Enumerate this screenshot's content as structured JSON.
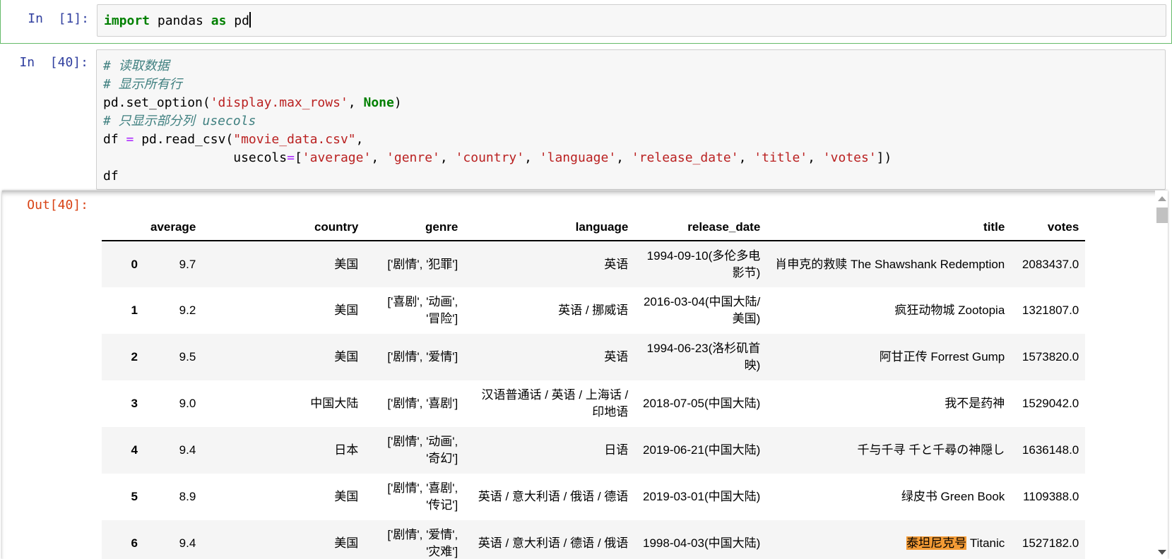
{
  "cells": [
    {
      "prompt": "In  [1]:",
      "lines": [
        [
          {
            "t": "kw",
            "v": "import"
          },
          {
            "t": "n",
            "v": " pandas "
          },
          {
            "t": "kw",
            "v": "as"
          },
          {
            "t": "n",
            "v": " pd"
          }
        ]
      ]
    },
    {
      "prompt": "In  [40]:",
      "lines": [
        [
          {
            "t": "cm",
            "v": "# 读取数据"
          }
        ],
        [
          {
            "t": "cm",
            "v": "# 显示所有行"
          }
        ],
        [
          {
            "t": "n",
            "v": "pd.set_option("
          },
          {
            "t": "str",
            "v": "'display.max_rows'"
          },
          {
            "t": "n",
            "v": ", "
          },
          {
            "t": "kw",
            "v": "None"
          },
          {
            "t": "n",
            "v": ")"
          }
        ],
        [
          {
            "t": "cm",
            "v": "# 只显示部分列 usecols"
          }
        ],
        [
          {
            "t": "n",
            "v": "df "
          },
          {
            "t": "op",
            "v": "="
          },
          {
            "t": "n",
            "v": " pd.read_csv("
          },
          {
            "t": "str",
            "v": "\"movie_data.csv\""
          },
          {
            "t": "n",
            "v": ","
          }
        ],
        [
          {
            "t": "n",
            "v": "                 usecols"
          },
          {
            "t": "op",
            "v": "="
          },
          {
            "t": "n",
            "v": "["
          },
          {
            "t": "str",
            "v": "'average'"
          },
          {
            "t": "n",
            "v": ", "
          },
          {
            "t": "str",
            "v": "'genre'"
          },
          {
            "t": "n",
            "v": ", "
          },
          {
            "t": "str",
            "v": "'country'"
          },
          {
            "t": "n",
            "v": ", "
          },
          {
            "t": "str",
            "v": "'language'"
          },
          {
            "t": "n",
            "v": ", "
          },
          {
            "t": "str",
            "v": "'release_date'"
          },
          {
            "t": "n",
            "v": ", "
          },
          {
            "t": "str",
            "v": "'title'"
          },
          {
            "t": "n",
            "v": ", "
          },
          {
            "t": "str",
            "v": "'votes'"
          },
          {
            "t": "n",
            "v": "])"
          }
        ],
        [
          {
            "t": "n",
            "v": "df"
          }
        ]
      ]
    }
  ],
  "output": {
    "prompt": "Out[40]:",
    "columns": [
      "",
      "average",
      "country",
      "genre",
      "language",
      "release_date",
      "title",
      "votes"
    ],
    "rows": [
      [
        "0",
        "9.7",
        "美国",
        "['剧情', '犯罪']",
        "英语",
        "1994-09-10(多伦多电影节)",
        "肖申克的救赎 The Shawshank Redemption",
        "2083437.0"
      ],
      [
        "1",
        "9.2",
        "美国",
        "['喜剧', '动画', '冒险']",
        "英语 / 挪威语",
        "2016-03-04(中国大陆/美国)",
        "疯狂动物城 Zootopia",
        "1321807.0"
      ],
      [
        "2",
        "9.5",
        "美国",
        "['剧情', '爱情']",
        "英语",
        "1994-06-23(洛杉矶首映)",
        "阿甘正传 Forrest Gump",
        "1573820.0"
      ],
      [
        "3",
        "9.0",
        "中国大陆",
        "['剧情', '喜剧']",
        "汉语普通话 / 英语 / 上海话 / 印地语",
        "2018-07-05(中国大陆)",
        "我不是药神",
        "1529042.0"
      ],
      [
        "4",
        "9.4",
        "日本",
        "['剧情', '动画', '奇幻']",
        "日语",
        "2019-06-21(中国大陆)",
        "千与千寻 千と千尋の神隠し",
        "1636148.0"
      ],
      [
        "5",
        "8.9",
        "美国",
        "['剧情', '喜剧', '传记']",
        "英语 / 意大利语 / 俄语 / 德语",
        "2019-03-01(中国大陆)",
        "绿皮书 Green Book",
        "1109388.0"
      ],
      [
        "6",
        "9.4",
        "美国",
        "['剧情', '爱情', '灾难']",
        "英语 / 意大利语 / 德语 / 俄语",
        "1998-04-03(中国大陆)",
        "泰坦尼克号 Titanic",
        "1527182.0"
      ]
    ],
    "highlight_text": "泰坦尼克号"
  },
  "colors": {
    "selected_border": "#66BB6A",
    "in_prompt": "#303F9F",
    "out_prompt": "#D84315",
    "code_bg": "#F7F7F7",
    "highlight": "#F49B35"
  }
}
